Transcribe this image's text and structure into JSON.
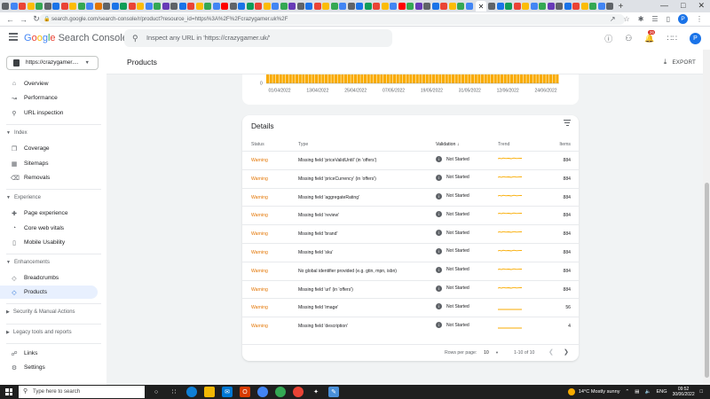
{
  "browser": {
    "url": "search.google.com/search-console/r/product?resource_id=https%3A%2F%2Fcrazygamer.uk%2F",
    "profile_initial": "P",
    "tab_colors": [
      "#5f6368",
      "#4285f4",
      "#ea4335",
      "#fbbc05",
      "#34a853",
      "#5f6368",
      "#1a73e8",
      "#ea4335",
      "#fbbc05",
      "#34a853",
      "#4285f4",
      "#e37400",
      "#5f6368",
      "#1a73e8",
      "#0f9d58",
      "#ea4335",
      "#fbbc05",
      "#4285f4",
      "#34a853",
      "#673ab7",
      "#5f6368",
      "#1a73e8",
      "#ea4335",
      "#fbbc05",
      "#34a853",
      "#4285f4",
      "#ff0000",
      "#5f6368",
      "#1a73e8",
      "#0f9d58",
      "#ea4335",
      "#fbbc05",
      "#4285f4",
      "#34a853",
      "#673ab7",
      "#5f6368",
      "#1a73e8",
      "#ea4335",
      "#fbbc05",
      "#34a853",
      "#4285f4",
      "#5f6368",
      "#1a73e8",
      "#0f9d58",
      "#ea4335",
      "#fbbc05",
      "#4285f4",
      "#ff0000",
      "#34a853",
      "#673ab7",
      "#5f6368",
      "#1a73e8",
      "#ea4335",
      "#fbbc05",
      "#34a853",
      "#4285f4",
      "#5f6368",
      "#1a73e8",
      "#0f9d58",
      "#ea4335",
      "#fbbc05",
      "#4285f4",
      "#34a853",
      "#673ab7",
      "#5f6368",
      "#1a73e8",
      "#ea4335",
      "#fbbc05",
      "#34a853",
      "#4285f4",
      "#5f6368"
    ]
  },
  "header": {
    "logo_google": [
      "G",
      "o",
      "o",
      "g",
      "l",
      "e"
    ],
    "logo_rest": "Search Console",
    "search_placeholder": "Inspect any URL in 'https://crazygamer.uk/'",
    "notification_count": "26",
    "profile_initial": "P"
  },
  "sidebar": {
    "property": "https://crazygamer....",
    "items": [
      {
        "label": "Overview",
        "icon": "home-icon"
      },
      {
        "label": "Performance",
        "icon": "trending-up-icon"
      },
      {
        "label": "URL inspection",
        "icon": "search-icon"
      }
    ],
    "index_section": "Index",
    "index_items": [
      {
        "label": "Coverage",
        "icon": "coverage-icon"
      },
      {
        "label": "Sitemaps",
        "icon": "sitemaps-icon"
      },
      {
        "label": "Removals",
        "icon": "removals-icon"
      }
    ],
    "experience_section": "Experience",
    "experience_items": [
      {
        "label": "Page experience",
        "icon": "page-experience-icon"
      },
      {
        "label": "Core web vitals",
        "icon": "speedometer-icon"
      },
      {
        "label": "Mobile Usability",
        "icon": "phone-icon"
      }
    ],
    "enhancements_section": "Enhancements",
    "enhancements_items": [
      {
        "label": "Breadcrumbs",
        "icon": "breadcrumbs-icon"
      },
      {
        "label": "Products",
        "icon": "products-icon",
        "active": true
      }
    ],
    "security_section": "Security & Manual Actions",
    "legacy_section": "Legacy tools and reports",
    "bottom_items": [
      {
        "label": "Links",
        "icon": "links-icon"
      },
      {
        "label": "Settings",
        "icon": "settings-icon"
      }
    ]
  },
  "page": {
    "title": "Products",
    "export_label": "EXPORT"
  },
  "chart_data": {
    "type": "bar",
    "y_tick_label": "0",
    "x_tick_labels": [
      "01/04/2022",
      "13/04/2022",
      "25/04/2022",
      "07/05/2022",
      "19/05/2022",
      "31/05/2022",
      "12/06/2022",
      "24/06/2022"
    ],
    "bar_color": "#f9ab00",
    "bar_count": 90
  },
  "details": {
    "title": "Details",
    "columns": {
      "status": "Status",
      "type": "Type",
      "validation": "Validation",
      "trend": "Trend",
      "items": "Items"
    },
    "rows": [
      {
        "status": "Warning",
        "type": "Missing field 'priceValidUntil' (in 'offers')",
        "validation": "Not Started",
        "items": "884"
      },
      {
        "status": "Warning",
        "type": "Missing field 'priceCurrency' (in 'offers')",
        "validation": "Not Started",
        "items": "884"
      },
      {
        "status": "Warning",
        "type": "Missing field 'aggregateRating'",
        "validation": "Not Started",
        "items": "884"
      },
      {
        "status": "Warning",
        "type": "Missing field 'review'",
        "validation": "Not Started",
        "items": "884"
      },
      {
        "status": "Warning",
        "type": "Missing field 'brand'",
        "validation": "Not Started",
        "items": "884"
      },
      {
        "status": "Warning",
        "type": "Missing field 'sku'",
        "validation": "Not Started",
        "items": "884"
      },
      {
        "status": "Warning",
        "type": "No global identifier provided (e.g. gtin, mpn, isbn)",
        "validation": "Not Started",
        "items": "884"
      },
      {
        "status": "Warning",
        "type": "Missing field 'url' (in 'offers')",
        "validation": "Not Started",
        "items": "884"
      },
      {
        "status": "Warning",
        "type": "Missing field 'image'",
        "validation": "Not Started",
        "items": "56"
      },
      {
        "status": "Warning",
        "type": "Missing field 'description'",
        "validation": "Not Started",
        "items": "4"
      }
    ],
    "pagination": {
      "rows_per_page_label": "Rows per page:",
      "rows_per_page": "10",
      "range": "1-10 of 10"
    }
  },
  "taskbar": {
    "search_placeholder": "Type here to search",
    "weather": "14°C  Mostly sunny",
    "lang": "ENG",
    "time": "09:52",
    "date": "30/06/2022"
  }
}
